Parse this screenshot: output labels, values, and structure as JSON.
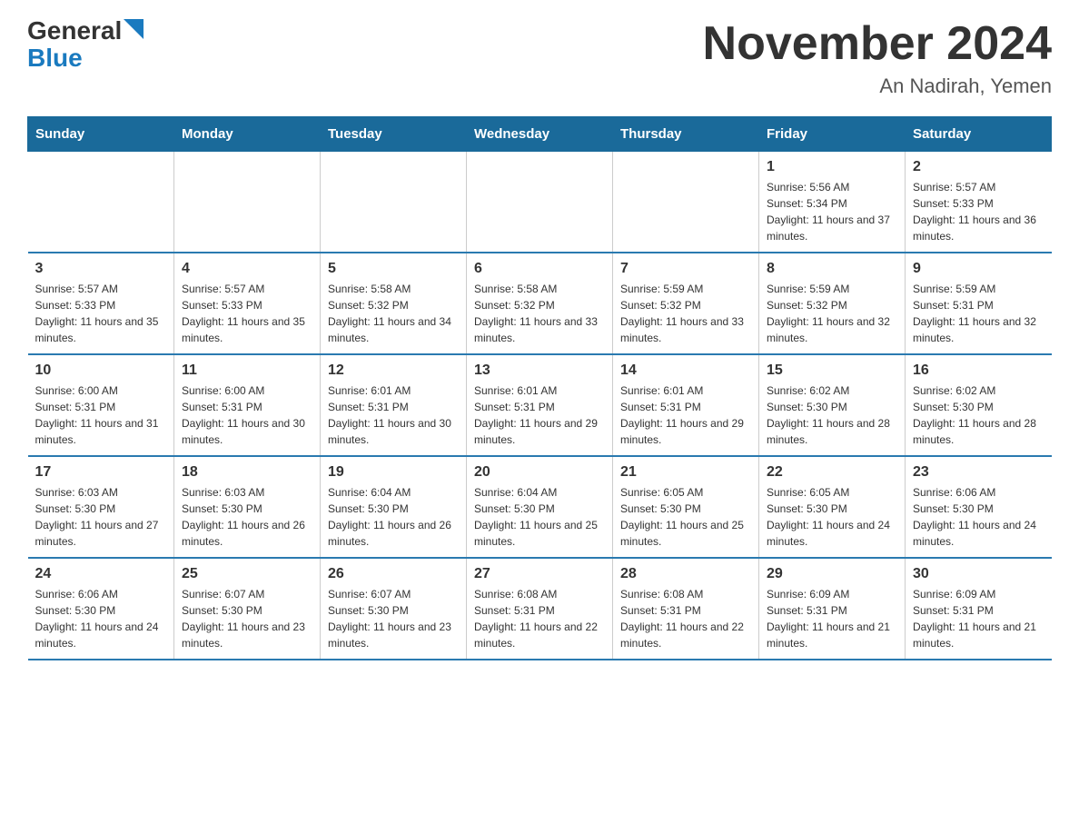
{
  "logo": {
    "general": "General",
    "blue": "Blue"
  },
  "title": {
    "month_year": "November 2024",
    "location": "An Nadirah, Yemen"
  },
  "weekdays": [
    "Sunday",
    "Monday",
    "Tuesday",
    "Wednesday",
    "Thursday",
    "Friday",
    "Saturday"
  ],
  "weeks": [
    [
      {
        "day": "",
        "info": ""
      },
      {
        "day": "",
        "info": ""
      },
      {
        "day": "",
        "info": ""
      },
      {
        "day": "",
        "info": ""
      },
      {
        "day": "",
        "info": ""
      },
      {
        "day": "1",
        "info": "Sunrise: 5:56 AM\nSunset: 5:34 PM\nDaylight: 11 hours and 37 minutes."
      },
      {
        "day": "2",
        "info": "Sunrise: 5:57 AM\nSunset: 5:33 PM\nDaylight: 11 hours and 36 minutes."
      }
    ],
    [
      {
        "day": "3",
        "info": "Sunrise: 5:57 AM\nSunset: 5:33 PM\nDaylight: 11 hours and 35 minutes."
      },
      {
        "day": "4",
        "info": "Sunrise: 5:57 AM\nSunset: 5:33 PM\nDaylight: 11 hours and 35 minutes."
      },
      {
        "day": "5",
        "info": "Sunrise: 5:58 AM\nSunset: 5:32 PM\nDaylight: 11 hours and 34 minutes."
      },
      {
        "day": "6",
        "info": "Sunrise: 5:58 AM\nSunset: 5:32 PM\nDaylight: 11 hours and 33 minutes."
      },
      {
        "day": "7",
        "info": "Sunrise: 5:59 AM\nSunset: 5:32 PM\nDaylight: 11 hours and 33 minutes."
      },
      {
        "day": "8",
        "info": "Sunrise: 5:59 AM\nSunset: 5:32 PM\nDaylight: 11 hours and 32 minutes."
      },
      {
        "day": "9",
        "info": "Sunrise: 5:59 AM\nSunset: 5:31 PM\nDaylight: 11 hours and 32 minutes."
      }
    ],
    [
      {
        "day": "10",
        "info": "Sunrise: 6:00 AM\nSunset: 5:31 PM\nDaylight: 11 hours and 31 minutes."
      },
      {
        "day": "11",
        "info": "Sunrise: 6:00 AM\nSunset: 5:31 PM\nDaylight: 11 hours and 30 minutes."
      },
      {
        "day": "12",
        "info": "Sunrise: 6:01 AM\nSunset: 5:31 PM\nDaylight: 11 hours and 30 minutes."
      },
      {
        "day": "13",
        "info": "Sunrise: 6:01 AM\nSunset: 5:31 PM\nDaylight: 11 hours and 29 minutes."
      },
      {
        "day": "14",
        "info": "Sunrise: 6:01 AM\nSunset: 5:31 PM\nDaylight: 11 hours and 29 minutes."
      },
      {
        "day": "15",
        "info": "Sunrise: 6:02 AM\nSunset: 5:30 PM\nDaylight: 11 hours and 28 minutes."
      },
      {
        "day": "16",
        "info": "Sunrise: 6:02 AM\nSunset: 5:30 PM\nDaylight: 11 hours and 28 minutes."
      }
    ],
    [
      {
        "day": "17",
        "info": "Sunrise: 6:03 AM\nSunset: 5:30 PM\nDaylight: 11 hours and 27 minutes."
      },
      {
        "day": "18",
        "info": "Sunrise: 6:03 AM\nSunset: 5:30 PM\nDaylight: 11 hours and 26 minutes."
      },
      {
        "day": "19",
        "info": "Sunrise: 6:04 AM\nSunset: 5:30 PM\nDaylight: 11 hours and 26 minutes."
      },
      {
        "day": "20",
        "info": "Sunrise: 6:04 AM\nSunset: 5:30 PM\nDaylight: 11 hours and 25 minutes."
      },
      {
        "day": "21",
        "info": "Sunrise: 6:05 AM\nSunset: 5:30 PM\nDaylight: 11 hours and 25 minutes."
      },
      {
        "day": "22",
        "info": "Sunrise: 6:05 AM\nSunset: 5:30 PM\nDaylight: 11 hours and 24 minutes."
      },
      {
        "day": "23",
        "info": "Sunrise: 6:06 AM\nSunset: 5:30 PM\nDaylight: 11 hours and 24 minutes."
      }
    ],
    [
      {
        "day": "24",
        "info": "Sunrise: 6:06 AM\nSunset: 5:30 PM\nDaylight: 11 hours and 24 minutes."
      },
      {
        "day": "25",
        "info": "Sunrise: 6:07 AM\nSunset: 5:30 PM\nDaylight: 11 hours and 23 minutes."
      },
      {
        "day": "26",
        "info": "Sunrise: 6:07 AM\nSunset: 5:30 PM\nDaylight: 11 hours and 23 minutes."
      },
      {
        "day": "27",
        "info": "Sunrise: 6:08 AM\nSunset: 5:31 PM\nDaylight: 11 hours and 22 minutes."
      },
      {
        "day": "28",
        "info": "Sunrise: 6:08 AM\nSunset: 5:31 PM\nDaylight: 11 hours and 22 minutes."
      },
      {
        "day": "29",
        "info": "Sunrise: 6:09 AM\nSunset: 5:31 PM\nDaylight: 11 hours and 21 minutes."
      },
      {
        "day": "30",
        "info": "Sunrise: 6:09 AM\nSunset: 5:31 PM\nDaylight: 11 hours and 21 minutes."
      }
    ]
  ]
}
